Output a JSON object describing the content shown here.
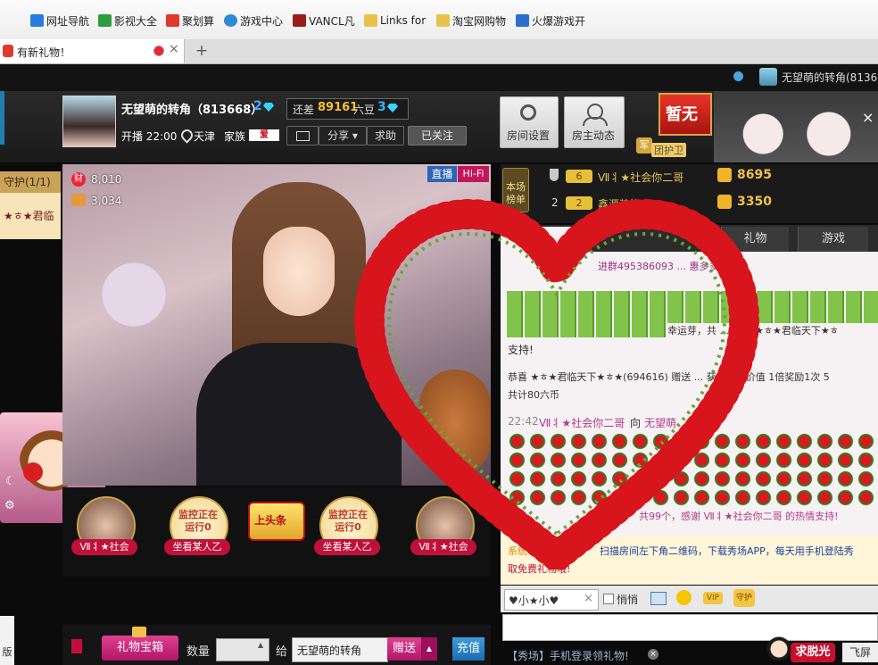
{
  "bookmarks": [
    {
      "label": "网址导航",
      "color": "#2a7be0"
    },
    {
      "label": "影视大全",
      "color": "#2a9e3f"
    },
    {
      "label": "聚划算",
      "color": "#e2372c"
    },
    {
      "label": "游戏中心",
      "color": "#2e8bd8"
    },
    {
      "label": "VANCL凡",
      "color": "#9b1b1b"
    },
    {
      "label": "Links for",
      "color": "#e8c24a"
    },
    {
      "label": "淘宝网购物",
      "color": "#e8c24a"
    },
    {
      "label": "火爆游戏开",
      "color": "#2a6fd0"
    }
  ],
  "tab": {
    "title": "有新礼物！",
    "close": "×",
    "new_tab": "+"
  },
  "user_bar": {
    "name": "无望萌的转角(8136"
  },
  "streamer": {
    "name": "无望萌的转角（813668）",
    "level": "2",
    "start_label": "开播 22:00",
    "location": "天津",
    "family_label": "家族",
    "family_badge": "爱",
    "gap_label": "还差",
    "gap_value": "89161",
    "gap_unit": "六豆",
    "gap_level": "3",
    "share": "分享",
    "ask": "求助",
    "follow": "已关注"
  },
  "header_buttons": {
    "room_settings": "房间设置",
    "host_news": "房主动态",
    "paused": "暂无",
    "guard_group": "团护卫",
    "guard_tag": "军"
  },
  "left_panel": {
    "guard": "守护(1/1)",
    "guard_member": "★ㅎ★君临"
  },
  "video": {
    "live": "直播",
    "hifi": "Hi-Fi",
    "wealth": "8,010",
    "fans": "3,034",
    "wealth_tag": "财"
  },
  "rank": {
    "title1": "本场",
    "title2": "榜单",
    "rows": [
      {
        "rank": "",
        "name": "Ⅶ丬★社会你二哥",
        "score": "8695",
        "badge": "6"
      },
      {
        "rank": "2",
        "name": "鑫源装饰李",
        "score": "3350",
        "badge": "2"
      }
    ]
  },
  "chat_tabs": [
    "全部",
    "礼物",
    "游戏"
  ],
  "chat": {
    "group_line": "进群495386093 ... 惠多多",
    "lucky_text": "幸运芽，共 ... 感谢 ★ㅎ★君临天下★ㅎ",
    "support": "支持!",
    "congrats": "恭喜 ★ㅎ★君临天下★ㅎ★(694616) 赠送 ... 获得礼物价值 1倍奖励1次 5",
    "total": "共计80六币",
    "time": "22:42",
    "sender": "Ⅶ丬★社会你二哥",
    "to": "向",
    "target": "无望萌",
    "thanks": "共99个，感谢 Ⅶ丬★社会你二哥 的热情支持!",
    "sys_label": "系统",
    "sys_msg": "扫描房间左下角二维码，下载秀场APP，每天用手机登陆秀",
    "sys_msg2": "取免费礼物哦!"
  },
  "chat_input": {
    "target": "♥小★小♥",
    "whisper": "悄悄",
    "vip": "VIP",
    "guard": "守护"
  },
  "gift_row": [
    {
      "label": "Ⅶ丬★社会"
    },
    {
      "label": "坐看某人乙",
      "top": "监控正在运行0"
    },
    {
      "label": "上头条"
    },
    {
      "label": "坐看某人乙",
      "top": "监控正在运行0"
    },
    {
      "label": "Ⅶ丬★社会"
    }
  ],
  "bottom": {
    "gift_box": "礼物宝箱",
    "qty_label": "数量",
    "to_label": "给",
    "recipient": "无望萌的转角",
    "send": "赠送",
    "recharge": "充值",
    "promo": "【秀场】手机登录领礼物!",
    "take_off": "求脱光",
    "fly": "飞屏",
    "side": "版"
  }
}
